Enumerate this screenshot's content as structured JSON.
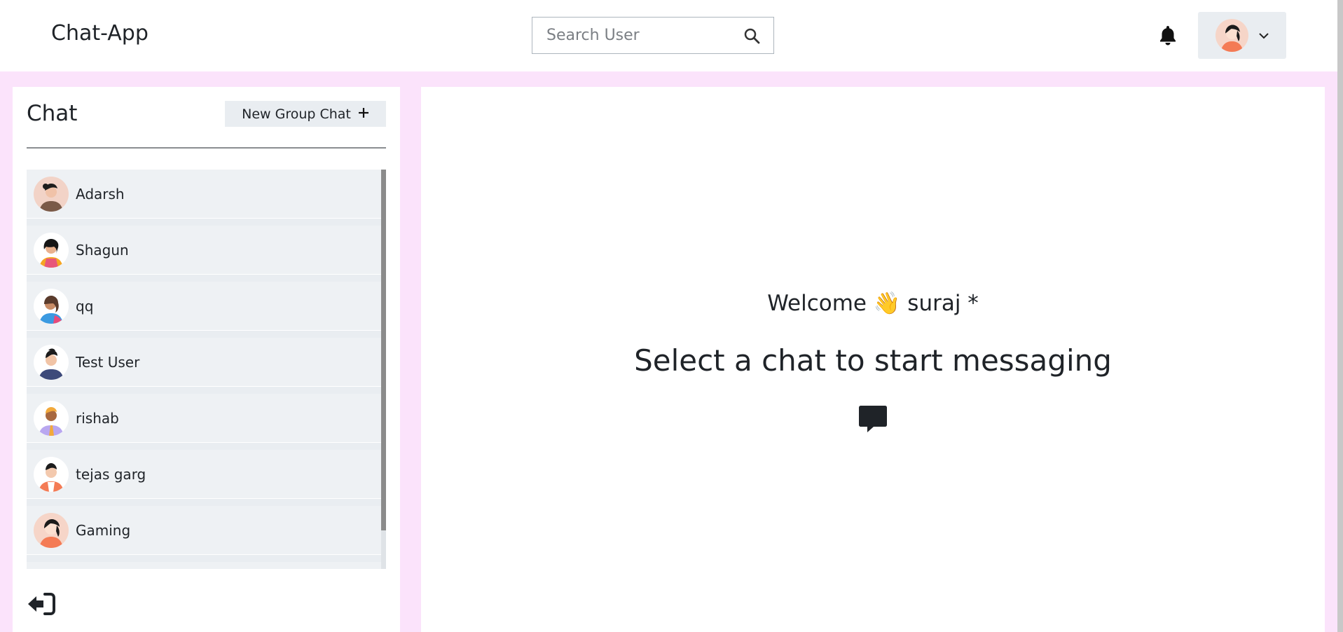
{
  "header": {
    "app_title": "Chat-App",
    "search_placeholder": "Search User",
    "icons": {
      "search": "search-icon",
      "bell": "bell-icon",
      "chevron": "chevron-down-icon"
    }
  },
  "sidebar": {
    "title": "Chat",
    "new_group_label": "New Group Chat",
    "chats": [
      {
        "name": "Adarsh"
      },
      {
        "name": "Shagun"
      },
      {
        "name": "qq"
      },
      {
        "name": "Test User"
      },
      {
        "name": "rishab"
      },
      {
        "name": "tejas garg"
      },
      {
        "name": "Gaming"
      }
    ],
    "logout_icon": "logout-icon"
  },
  "main": {
    "welcome_text": "Welcome 👋 suraj *",
    "select_text": "Select a chat to start messaging",
    "icon": "chat-bubble-icon"
  },
  "colors": {
    "background": "#fbe3fb",
    "panel": "#ffffff",
    "item_bg": "#eef1f4",
    "accent_text": "#1f2328"
  }
}
